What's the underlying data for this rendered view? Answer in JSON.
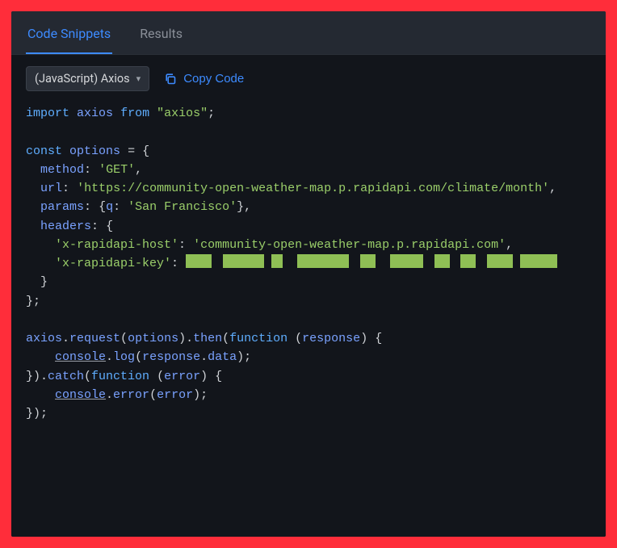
{
  "tabs": [
    {
      "label": "Code Snippets",
      "active": true
    },
    {
      "label": "Results",
      "active": false
    }
  ],
  "toolbar": {
    "language_select_label": "(JavaScript) Axios",
    "copy_label": "Copy Code"
  },
  "code": {
    "import_kw": "import",
    "import_ident": "axios",
    "from_kw": "from",
    "import_src": "\"axios\"",
    "const_kw": "const",
    "options_ident": "options",
    "method_key": "method",
    "method_val": "'GET'",
    "url_key": "url",
    "url_val": "'https://community-open-weather-map.p.rapidapi.com/climate/month'",
    "params_key": "params",
    "params_q_key": "q",
    "params_q_val": "'San Francisco'",
    "headers_key": "headers",
    "host_key": "'x-rapidapi-host'",
    "host_val": "'community-open-weather-map.p.rapidapi.com'",
    "apikey_key": "'x-rapidapi-key'",
    "axios_ident": "axios",
    "request_ident": "request",
    "options_ref": "options",
    "then_ident": "then",
    "function_kw": "function",
    "response_ident": "response",
    "console_ident": "console",
    "log_ident": "log",
    "data_ident": "data",
    "catch_ident": "catch",
    "error_ident": "error",
    "error_fn": "error"
  }
}
